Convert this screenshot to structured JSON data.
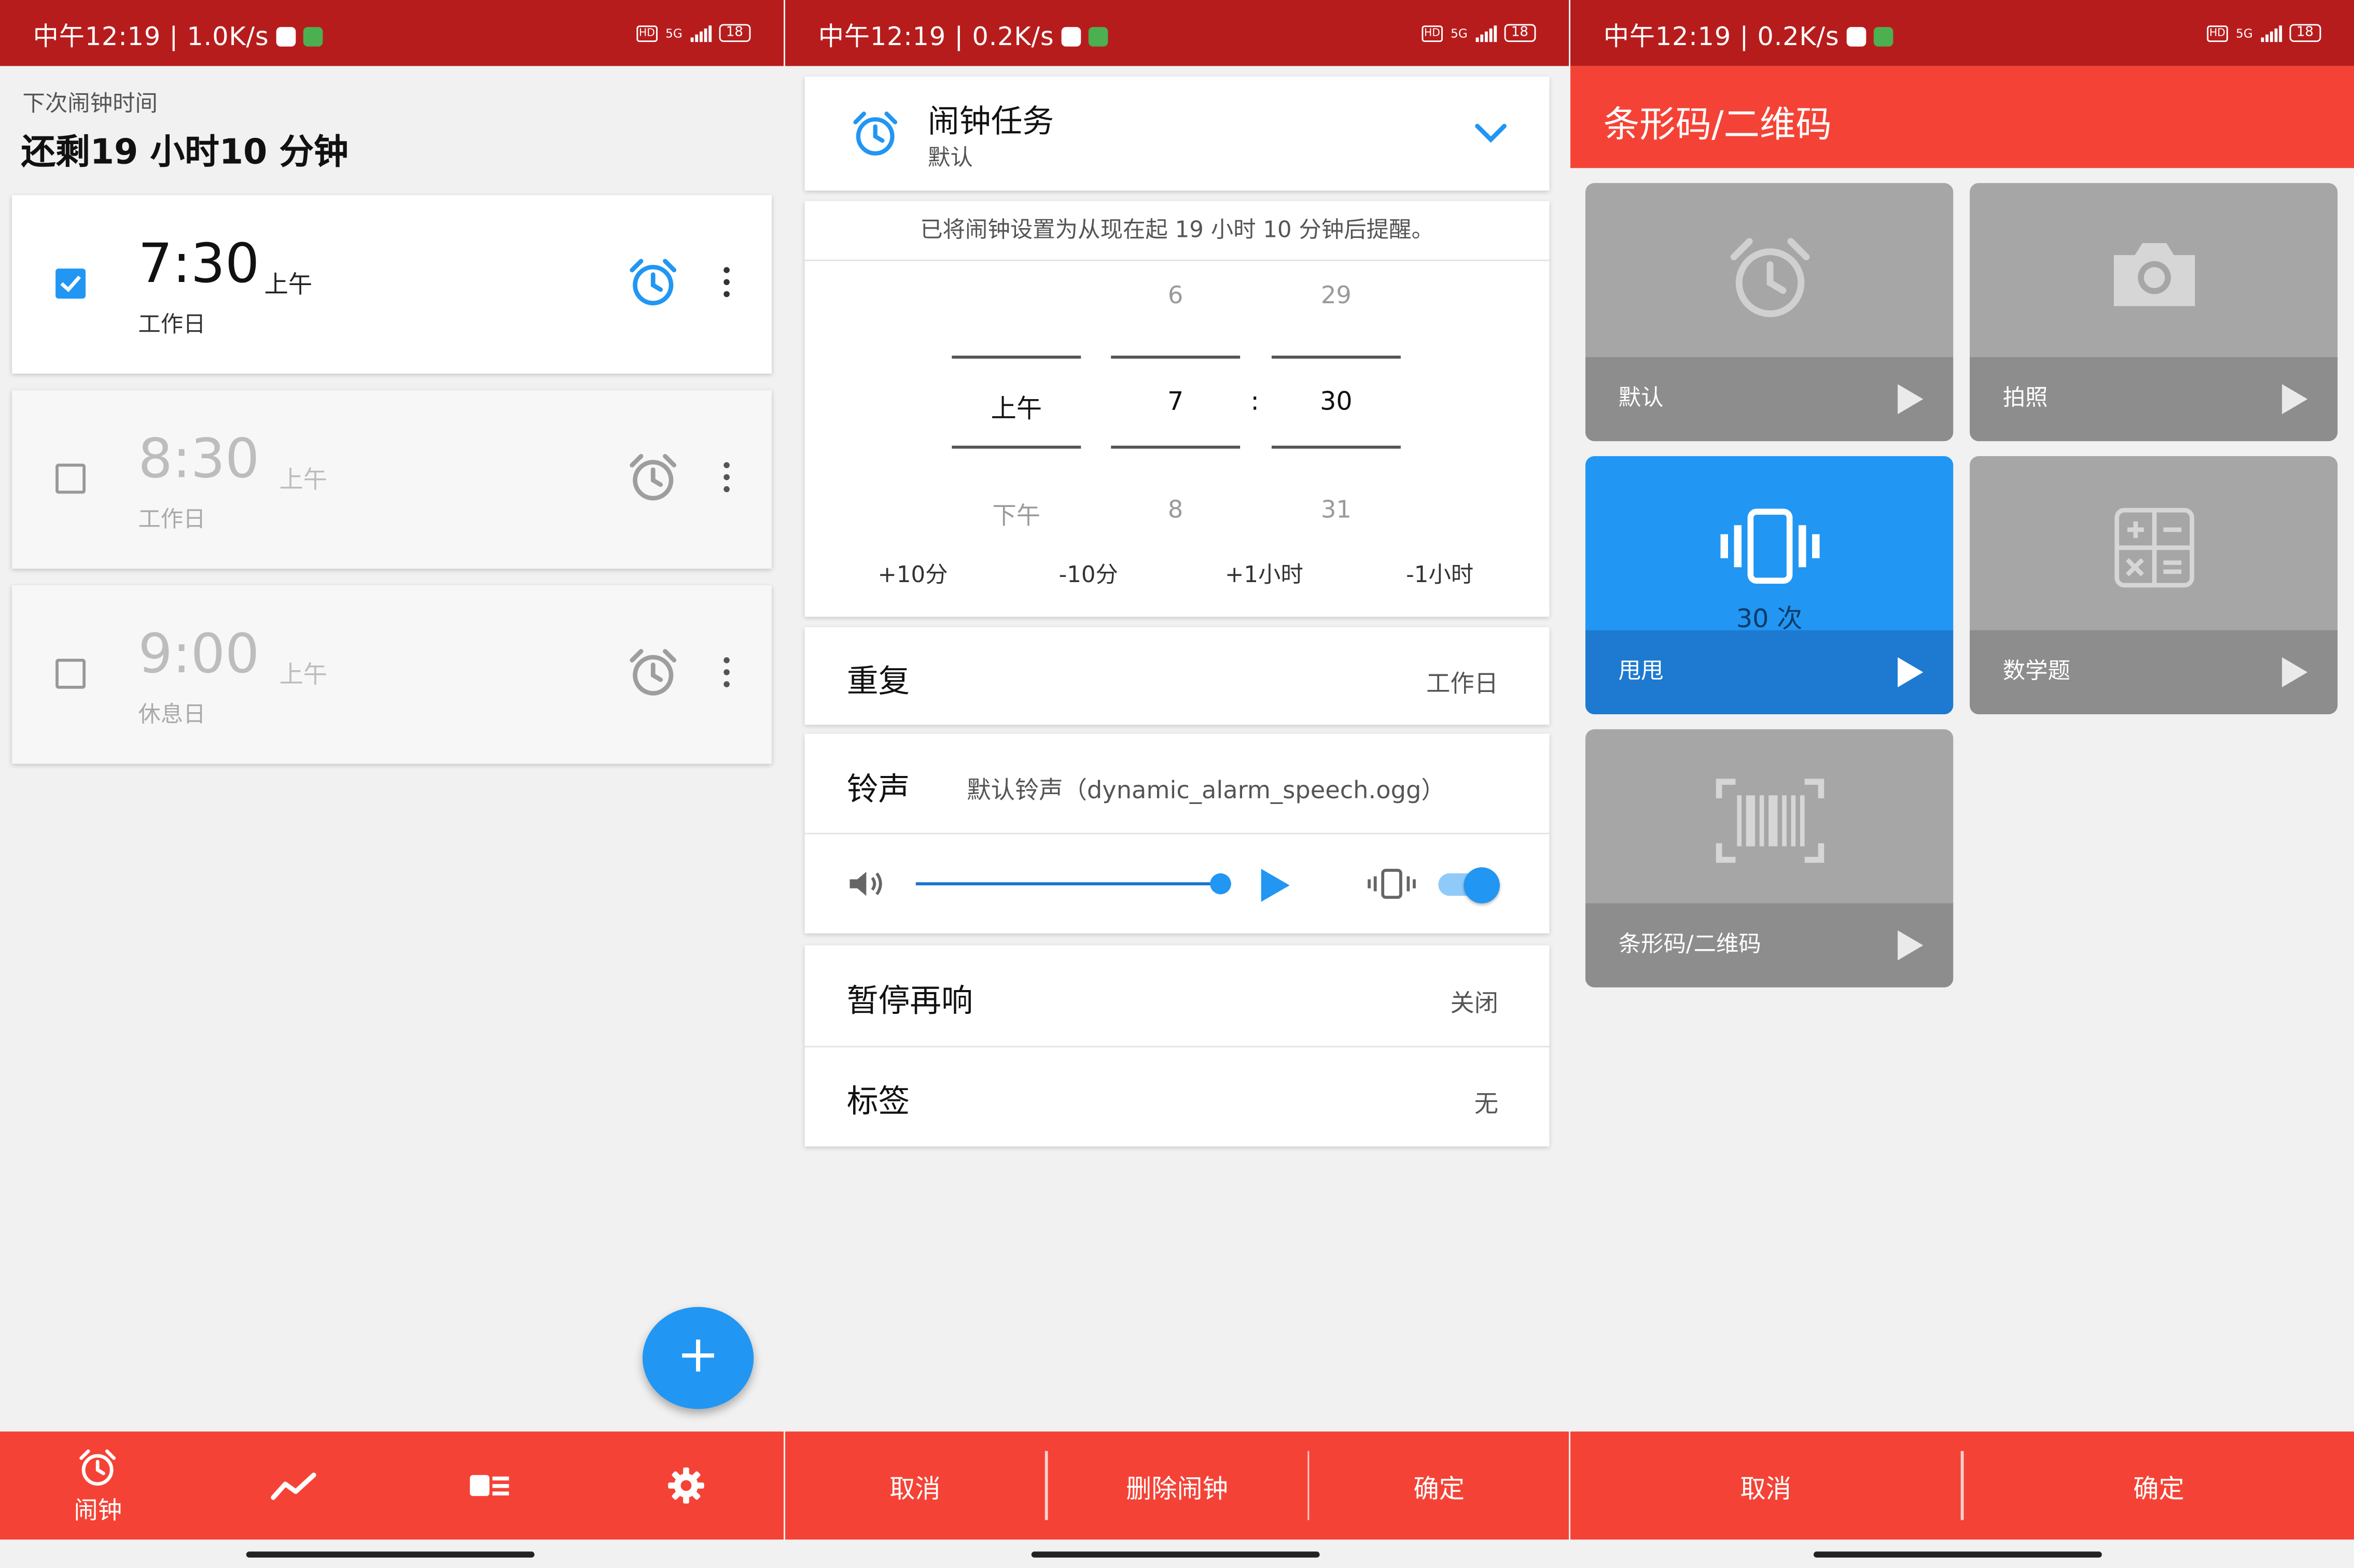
{
  "status_bars": [
    {
      "time": "中午12:19",
      "speed": "1.0K/s"
    },
    {
      "time": "中午12:19",
      "speed": "0.2K/s"
    },
    {
      "time": "中午12:19",
      "speed": "0.2K/s"
    }
  ],
  "status_icons": {
    "hd": "HD",
    "network": "5G",
    "battery": "18"
  },
  "alarm_list": {
    "next_label": "下次闹钟时间",
    "next_value": "还剩19 小时10 分钟",
    "alarms": [
      {
        "time": "7:30",
        "ampm": "上午",
        "days": "工作日",
        "enabled": true
      },
      {
        "time": "8:30",
        "ampm": "上午",
        "days": "工作日",
        "enabled": false
      },
      {
        "time": "9:00",
        "ampm": "上午",
        "days": "休息日",
        "enabled": false
      }
    ],
    "fab_label": "+",
    "nav": [
      {
        "label": "闹钟",
        "icon": "alarm-clock-icon"
      },
      {
        "label": "",
        "icon": "trend-line-icon"
      },
      {
        "label": "",
        "icon": "id-card-list-icon"
      },
      {
        "label": "",
        "icon": "gear-icon"
      }
    ]
  },
  "alarm_edit": {
    "task_title": "闹钟任务",
    "task_sub": "默认",
    "banner": "已将闹钟设置为从现在起 19 小时 10 分钟后提醒。",
    "picker": {
      "ampm": {
        "above": "",
        "selected": "上午",
        "below": "下午"
      },
      "hour": {
        "above": "6",
        "selected": "7",
        "below": "8"
      },
      "separator": ":",
      "minute": {
        "above": "29",
        "selected": "30",
        "below": "31"
      }
    },
    "adjust_buttons": [
      "+10分",
      "-10分",
      "+1小时",
      "-1小时"
    ],
    "repeat": {
      "label": "重复",
      "value": "工作日"
    },
    "ringtone": {
      "label": "铃声",
      "value": "默认铃声（dynamic_alarm_speech.ogg）"
    },
    "volume_level": 1.0,
    "vibrate_on": true,
    "snooze": {
      "label": "暂停再响",
      "value": "关闭"
    },
    "tag": {
      "label": "标签",
      "value": "无"
    },
    "actions": {
      "cancel": "取消",
      "delete": "删除闹钟",
      "confirm": "确定"
    }
  },
  "task_select": {
    "title": "条形码/二维码",
    "tiles": [
      {
        "label": "默认",
        "icon": "alarm-clock-icon",
        "selected": false
      },
      {
        "label": "拍照",
        "icon": "camera-icon",
        "selected": false
      },
      {
        "label": "甩甩",
        "icon": "vibrate-phone-icon",
        "selected": true,
        "count": "30 次"
      },
      {
        "label": "数学题",
        "icon": "calculator-icon",
        "selected": false
      },
      {
        "label": "条形码/二维码",
        "icon": "barcode-scan-icon",
        "selected": false
      }
    ],
    "actions": {
      "cancel": "取消",
      "confirm": "确定"
    }
  },
  "colors": {
    "statusbar": "#b71c1c",
    "accent_red": "#f44336",
    "blue": "#2196f3",
    "tile_gray": "#a6a6a6"
  }
}
